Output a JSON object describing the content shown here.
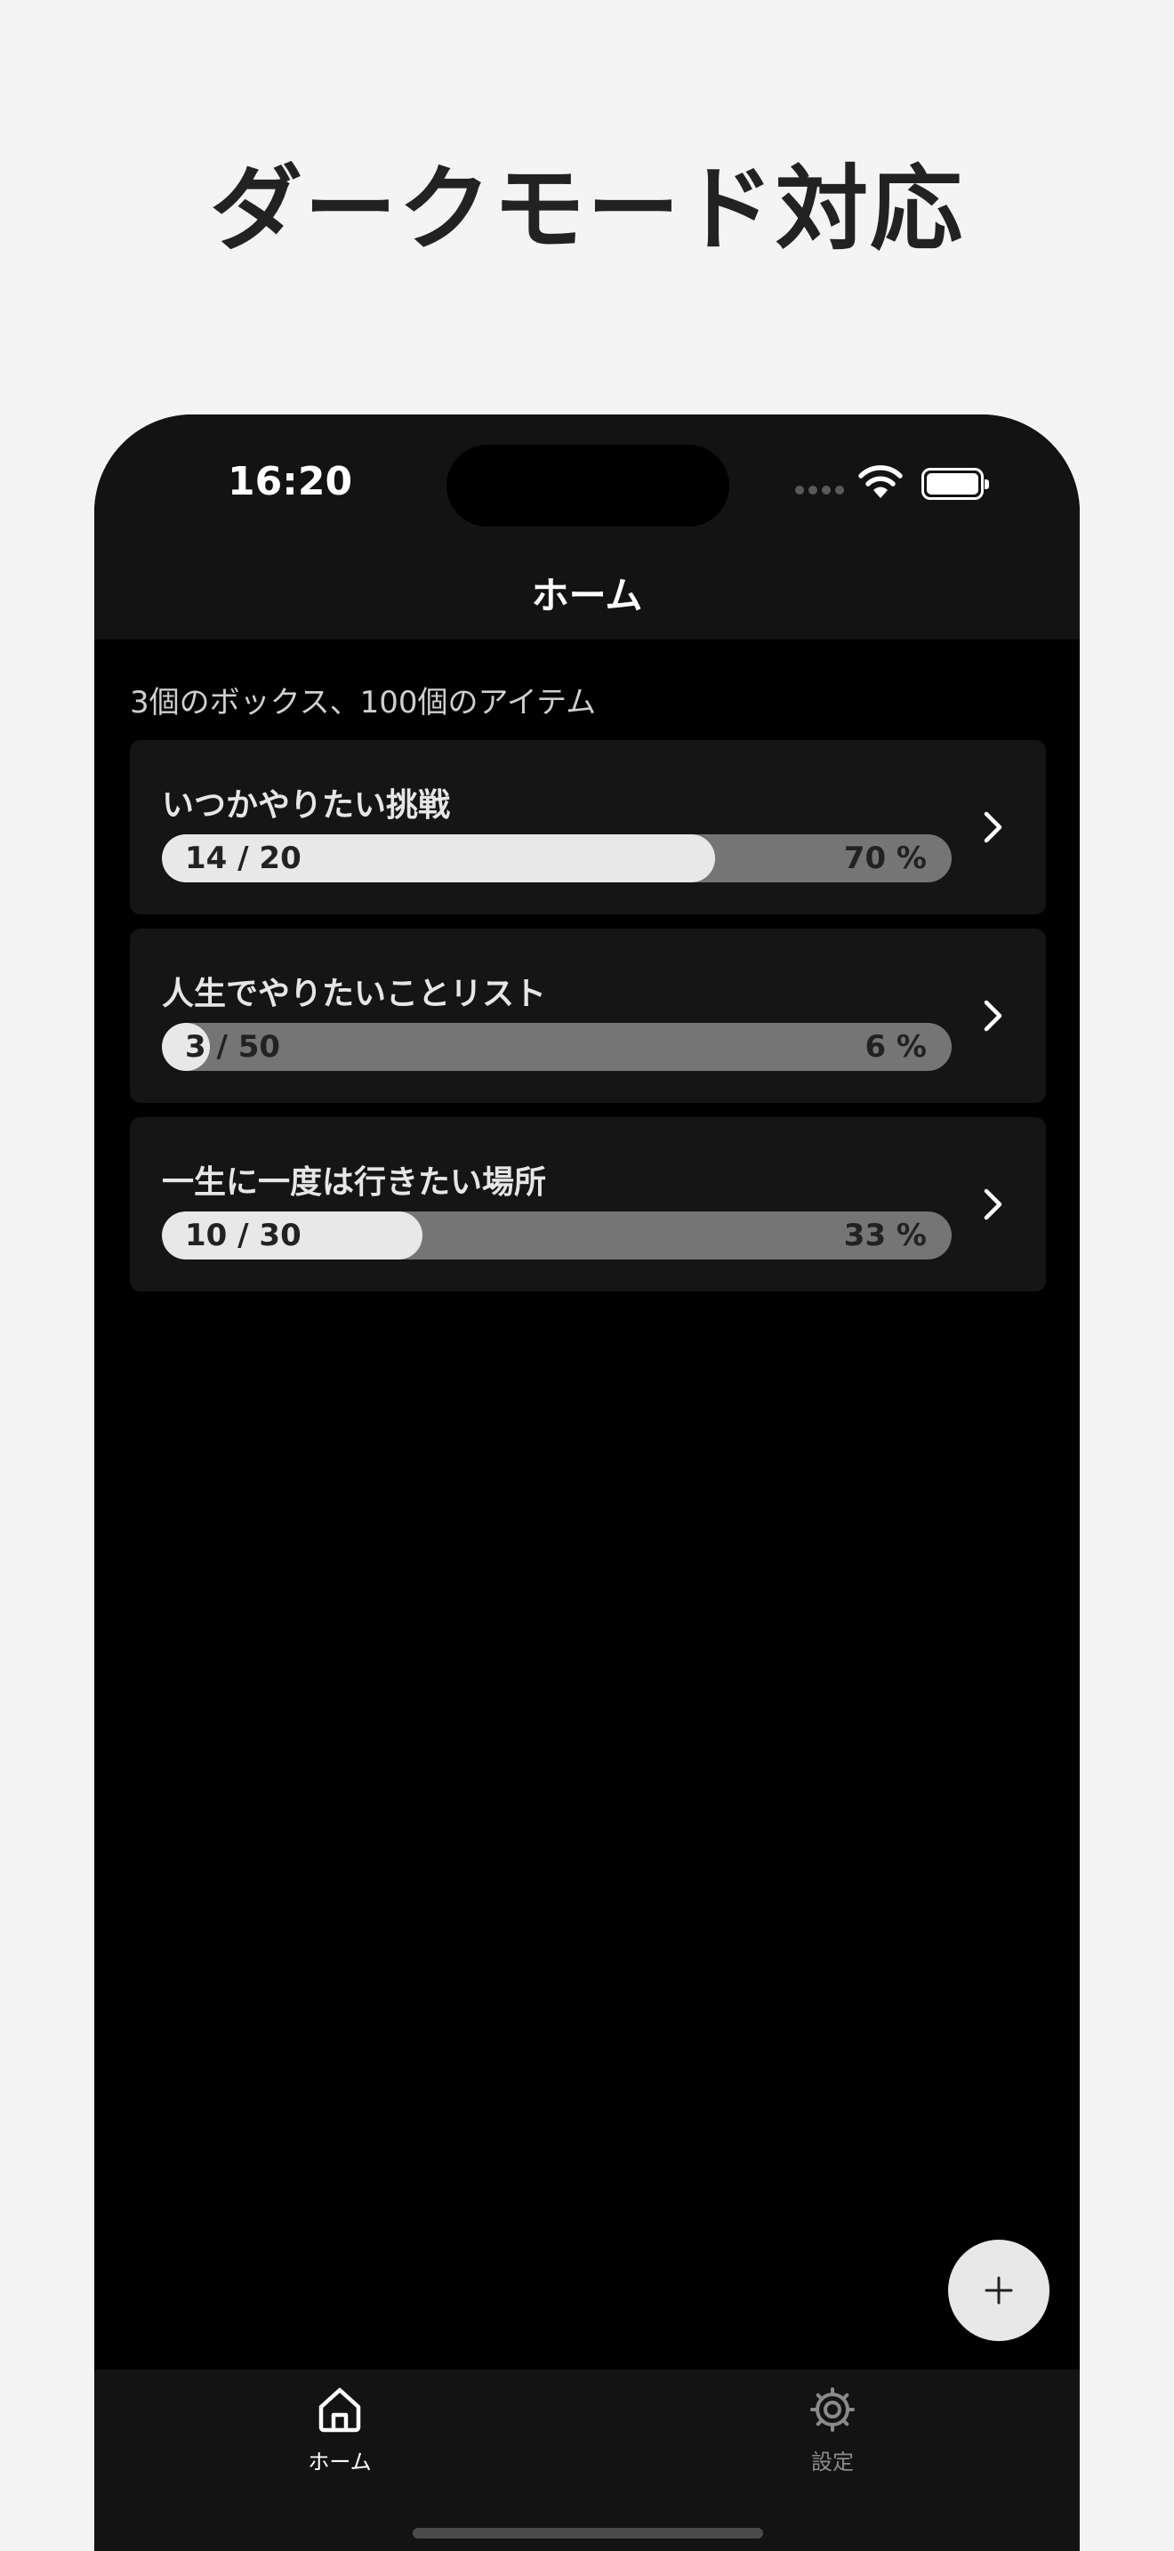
{
  "headline": "ダークモード対応",
  "status_bar": {
    "time": "16:20"
  },
  "nav": {
    "title": "ホーム"
  },
  "summary": "3個のボックス、100個のアイテム",
  "boxes": [
    {
      "title": "いつかやりたい挑戦",
      "count": "14 / 20",
      "percent_label": "70 %",
      "progress": 0.7
    },
    {
      "title": "人生でやりたいことリスト",
      "count": "3 / 50",
      "percent_label": "6 %",
      "progress": 0.06
    },
    {
      "title": "一生に一度は行きたい場所",
      "count": "10 / 30",
      "percent_label": "33 %",
      "progress": 0.33
    }
  ],
  "fab": {
    "icon": "plus-icon"
  },
  "tabbar": {
    "items": [
      {
        "label": "ホーム",
        "icon": "home-icon",
        "active": true
      },
      {
        "label": "設定",
        "icon": "gear-icon",
        "active": false
      }
    ]
  },
  "colors": {
    "background": "#000000",
    "accent": "#e8e8e8",
    "card": "#151515",
    "bar_track": "#757575"
  }
}
